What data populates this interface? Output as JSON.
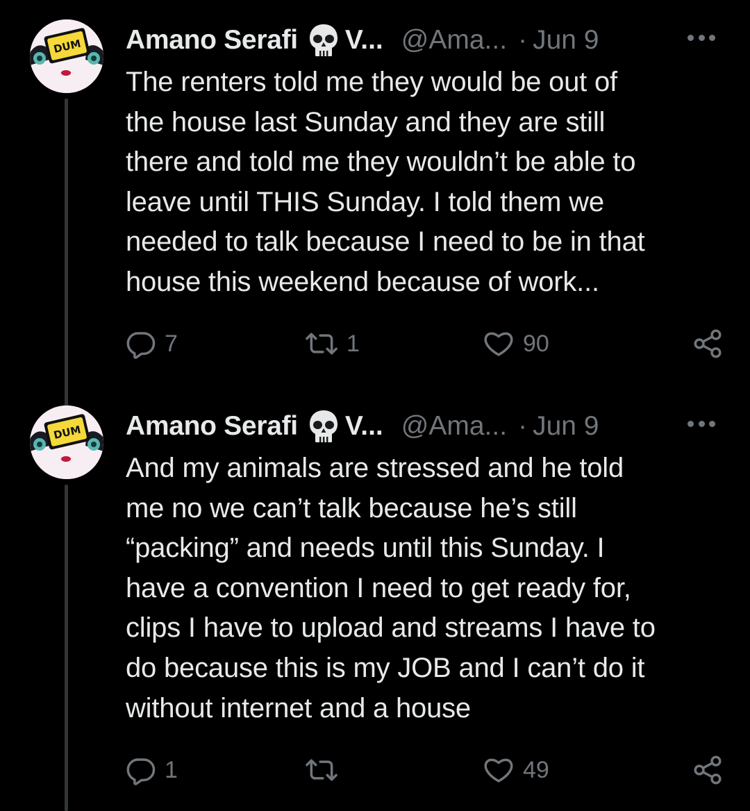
{
  "theme": {
    "background": "#000000",
    "text_primary": "#e7e9ea",
    "text_secondary": "#71767b",
    "thread_line": "#333639"
  },
  "tweets": [
    {
      "author": {
        "display_name": "Amano Serafi",
        "emoji_icon": "skull-icon",
        "name_truncated": "V...",
        "handle": "@Ama...",
        "avatar_sign_text": "DUM"
      },
      "separator": "·",
      "date": "Jun 9",
      "text": "The renters told me they would be out of\nthe house last Sunday and they are still\nthere and told me they wouldn’t be able to\nleave until THIS Sunday. I told them we\nneeded to talk because I need to be in that\nhouse this weekend because of work...",
      "metrics": {
        "replies": "7",
        "retweets": "1",
        "likes": "90"
      }
    },
    {
      "author": {
        "display_name": "Amano Serafi",
        "emoji_icon": "skull-icon",
        "name_truncated": "V...",
        "handle": "@Ama...",
        "avatar_sign_text": "DUM"
      },
      "separator": "·",
      "date": "Jun 9",
      "text": "And my animals are stressed and he told\nme no we can’t talk because he’s still\n“packing” and needs until this Sunday. I\nhave a convention I need to get ready for,\nclips I have to upload and streams I have to\ndo because this is my JOB and I can’t do it\nwithout internet and a house",
      "metrics": {
        "replies": "1",
        "retweets": "",
        "likes": "49"
      }
    }
  ]
}
